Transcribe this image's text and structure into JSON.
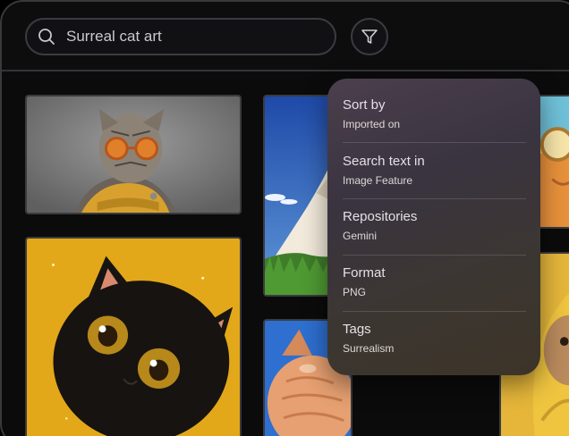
{
  "search": {
    "placeholder": "Surreal cat art",
    "value": ""
  },
  "icons": {
    "search": "search-icon",
    "filter": "filter-icon"
  },
  "gallery": {
    "images": [
      {
        "subject": "tabby cat with orange sunglasses and yellow scarf"
      },
      {
        "subject": "black kitten on yellow background"
      },
      {
        "subject": "snowy mountain peak with grass under blue sky"
      },
      {
        "subject": "orange cat looking up against blue sky"
      },
      {
        "subject": "orange cat wearing glasses at the beach"
      },
      {
        "subject": "cat in yellow hooded raincoat"
      }
    ]
  },
  "filter_menu": {
    "items": [
      {
        "label": "Sort by",
        "value": "Imported on"
      },
      {
        "label": "Search text in",
        "value": "Image Feature"
      },
      {
        "label": "Repositories",
        "value": "Gemini"
      },
      {
        "label": "Format",
        "value": "PNG"
      },
      {
        "label": "Tags",
        "value": "Surrealism"
      }
    ]
  }
}
